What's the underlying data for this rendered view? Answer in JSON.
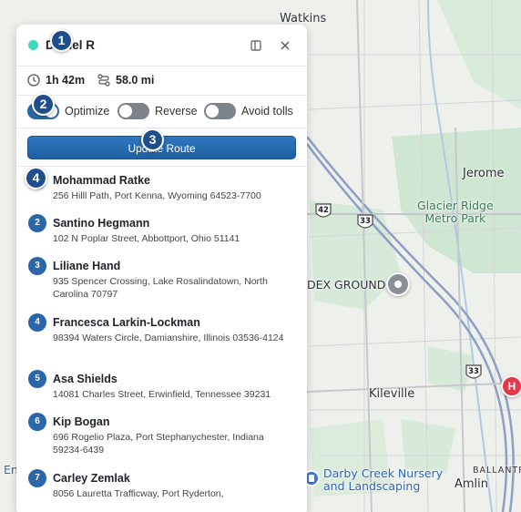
{
  "map": {
    "labels": {
      "watkins": "Watkins",
      "jerome": "Jerome",
      "park": "Glacier Ridge\nMetro Park",
      "dex_ground": "DEX GROUND",
      "kileville": "Kileville",
      "nursery": "Darby Creek Nursery\nand Landscaping",
      "amlin": "Amlin",
      "ballantrae": "BALLANTR",
      "edge": "En"
    },
    "shields": {
      "route42": "42",
      "route33a": "33",
      "route33b": "33"
    },
    "hospital_marker": "H"
  },
  "panel": {
    "title": "Daniel R",
    "status_color": "#3fd6be",
    "stats": {
      "duration": "1h 42m",
      "distance": "58.0 mi"
    },
    "toggles": [
      {
        "label": "Optimize",
        "on": true
      },
      {
        "label": "Reverse",
        "on": false
      },
      {
        "label": "Avoid tolls",
        "on": false
      }
    ],
    "update_button": "Update Route",
    "stops": [
      {
        "num": "1",
        "name": "Mohammad Ratke",
        "address": "256 Hilll Path, Port Kenna, Wyoming 64523-7700"
      },
      {
        "num": "2",
        "name": "Santino Hegmann",
        "address": "102 N Poplar Street, Abbottport, Ohio 51141"
      },
      {
        "num": "3",
        "name": "Liliane Hand",
        "address": "935 Spencer Crossing, Lake Rosalindatown, North Carolina 70797"
      },
      {
        "num": "4",
        "name": "Francesca Larkin-Lockman",
        "address": "98394 Waters Circle, Damianshire, Illinois 03536-4124"
      },
      {
        "num": "5",
        "name": "Asa Shields",
        "address": "14081 Charles Street, Erwinfield, Tennessee 39231"
      },
      {
        "num": "6",
        "name": "Kip Bogan",
        "address": "696 Rogelio Plaza, Port Stephanychester, Indiana 59234-6439"
      },
      {
        "num": "7",
        "name": "Carley Zemlak",
        "address": "8056 Lauretta Trafficway, Port Ryderton,"
      }
    ]
  },
  "badges": [
    "1",
    "2",
    "3",
    "4"
  ],
  "colors": {
    "accent": "#2a66a8",
    "badge": "#1e4f8a",
    "toggle_off": "#7d838a"
  }
}
